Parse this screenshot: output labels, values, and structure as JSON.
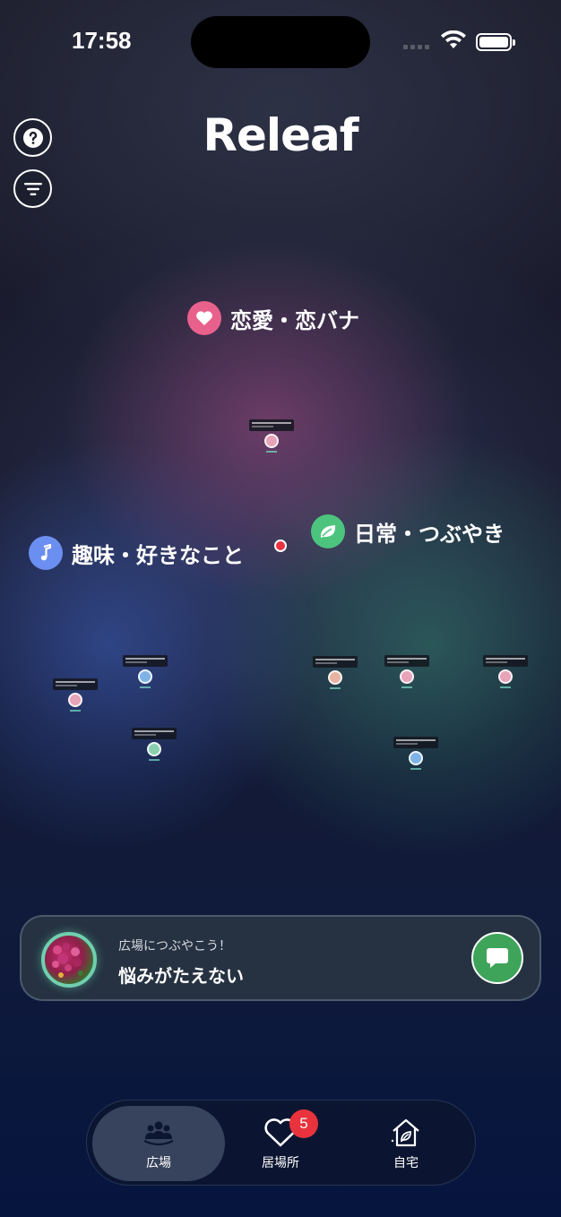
{
  "status_bar": {
    "time": "17:58"
  },
  "header": {
    "title": "Releaf"
  },
  "categories": [
    {
      "label": "恋愛・恋バナ",
      "color": "#e8618c",
      "icon": "heart-icon"
    },
    {
      "label": "趣味・好きなこと",
      "color": "#6b8ff0",
      "icon": "music-note-icon"
    },
    {
      "label": "日常・つぶやき",
      "color": "#4cc47e",
      "icon": "leaf-icon"
    }
  ],
  "composer": {
    "prompt": "広場につぶやこう！",
    "text": "悩みがたえない"
  },
  "tabs": [
    {
      "label": "広場",
      "icon": "people-icon",
      "active": true
    },
    {
      "label": "居場所",
      "icon": "heart-outline-icon",
      "badge": "5"
    },
    {
      "label": "自宅",
      "icon": "home-leaf-icon"
    }
  ],
  "colors": {
    "accent_green": "#3ea45a",
    "badge_red": "#e8333d",
    "center_dot": "#ec3040"
  }
}
